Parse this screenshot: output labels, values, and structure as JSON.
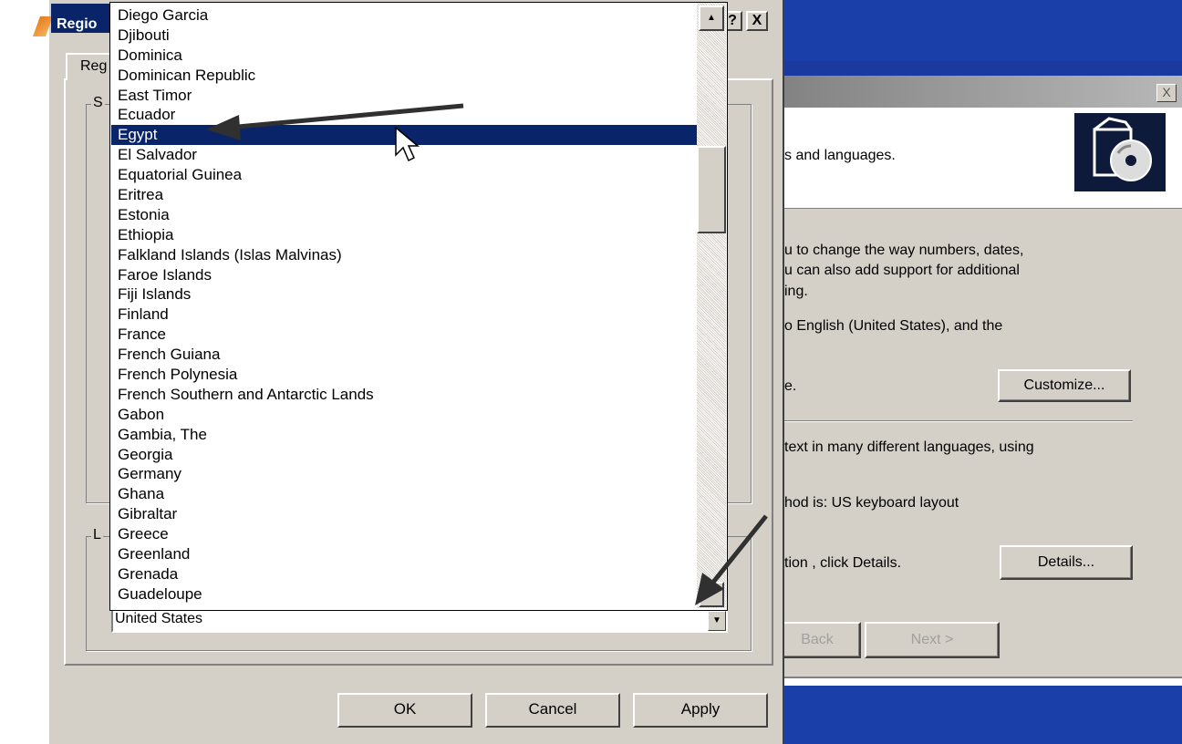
{
  "dialog": {
    "title": "Regio",
    "tab": "Reg",
    "group1_label": "S",
    "group2_label": "L",
    "help_label": "?",
    "close_label": "X",
    "buttons": {
      "ok": "OK",
      "cancel": "Cancel",
      "apply": "Apply"
    }
  },
  "combo": {
    "value": "United States",
    "arrow": "▼"
  },
  "dropdown": {
    "items": [
      "Diego Garcia",
      "Djibouti",
      "Dominica",
      "Dominican Republic",
      "East Timor",
      "Ecuador",
      "Egypt",
      "El Salvador",
      "Equatorial Guinea",
      "Eritrea",
      "Estonia",
      "Ethiopia",
      "Falkland Islands (Islas Malvinas)",
      "Faroe Islands",
      "Fiji Islands",
      "Finland",
      "France",
      "French Guiana",
      "French Polynesia",
      "French Southern and Antarctic Lands",
      "Gabon",
      "Gambia, The",
      "Georgia",
      "Germany",
      "Ghana",
      "Gibraltar",
      "Greece",
      "Greenland",
      "Grenada",
      "Guadeloupe"
    ],
    "selected": "Egypt",
    "scroll_up": "▲",
    "scroll_down": "▼"
  },
  "wizard": {
    "close_label": "X",
    "header_text": "s and languages.",
    "para1_line1": "u to change the way numbers, dates,",
    "para1_line2": "u can also add support for additional",
    "para1_line3": "ing.",
    "para2": "o English (United States), and the",
    "line_e": "e.",
    "customize_label": "Customize...",
    "para3": "text in many different languages, using",
    "para4": "hod is: US keyboard layout",
    "para5": "tion , click Details.",
    "details_label": "Details...",
    "back_label": "Back",
    "next_label": "Next >"
  }
}
